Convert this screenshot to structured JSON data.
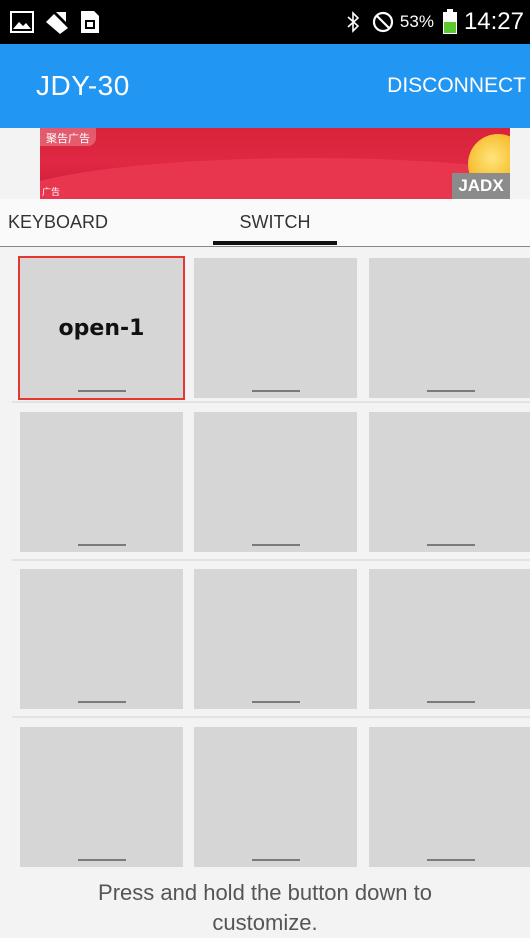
{
  "status_bar": {
    "battery_percent": "53%",
    "time": "14:27",
    "icons": [
      "image-icon",
      "signal-icon",
      "sim-icon",
      "bluetooth-icon",
      "block-icon",
      "battery-icon"
    ]
  },
  "app_bar": {
    "title": "JDY-30",
    "action_label": "DISCONNECT",
    "color": "#2196f3"
  },
  "ad": {
    "tag": "聚告广告",
    "bottom_tag": "广告",
    "badge": "JADX"
  },
  "tabs": [
    {
      "label": "KEYBOARD"
    },
    {
      "label": "SWITCH"
    }
  ],
  "grid": {
    "rows": [
      [
        "open-1",
        "",
        ""
      ],
      [
        "",
        "",
        ""
      ],
      [
        "",
        "",
        ""
      ],
      [
        "",
        "",
        ""
      ]
    ],
    "selected_index": 0
  },
  "footer_hint": "Press and hold the button down to customize."
}
